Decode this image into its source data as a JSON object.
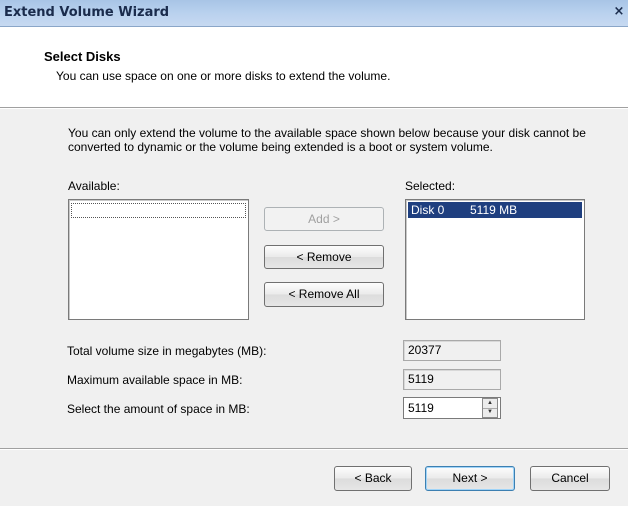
{
  "window": {
    "title": "Extend Volume Wizard",
    "close_glyph": "×"
  },
  "header": {
    "title": "Select Disks",
    "subtitle": "You can use space on one or more disks to extend the volume."
  },
  "info_text": "You can only extend the volume to the available space shown below because your disk cannot be converted to dynamic or the volume being extended is a boot or system volume.",
  "available": {
    "label": "Available:",
    "items": []
  },
  "selected": {
    "label": "Selected:",
    "items": [
      {
        "disk": "Disk 0",
        "size": "5119 MB"
      }
    ]
  },
  "buttons": {
    "add": "Add >",
    "remove": "< Remove",
    "remove_all": "< Remove All",
    "back": "< Back",
    "next": "Next >",
    "cancel": "Cancel"
  },
  "fields": {
    "total_label": "Total volume size in megabytes (MB):",
    "total_value": "20377",
    "max_label": "Maximum available space in MB:",
    "max_value": "5119",
    "amount_label": "Select the amount of space in MB:",
    "amount_value": "5119"
  },
  "icons": {
    "spin_up": "▲",
    "spin_down": "▼"
  },
  "colors": {
    "selection": "#1f3f7f",
    "titlebar": "#b9d1ee"
  }
}
